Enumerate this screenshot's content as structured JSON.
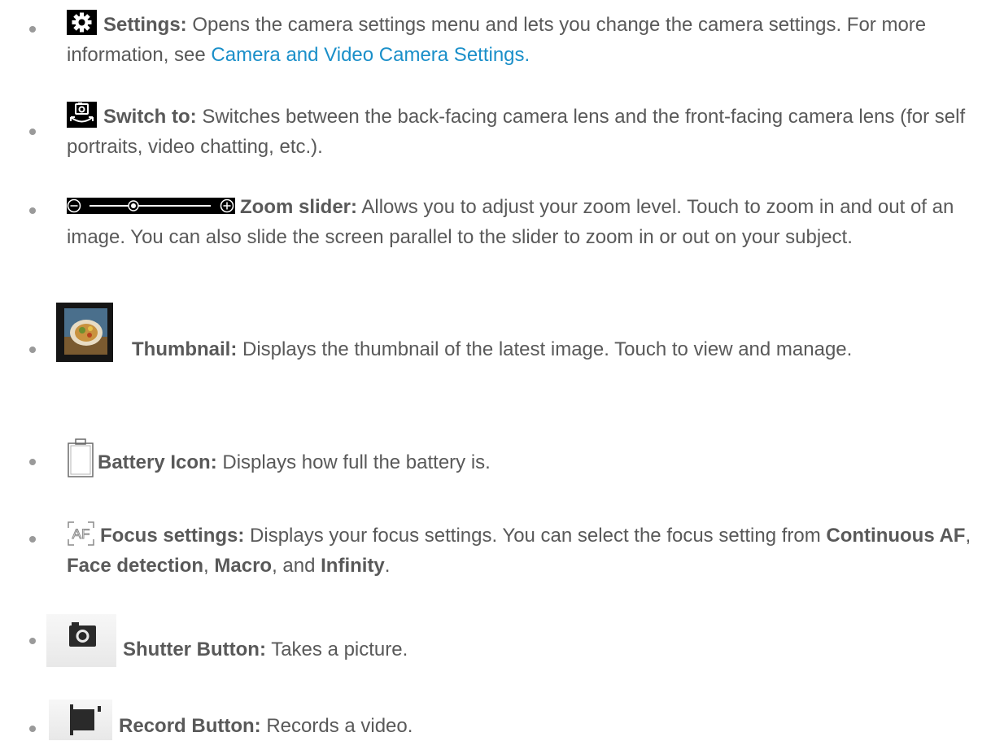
{
  "items": [
    {
      "icon": "gear-icon",
      "term": "Settings:",
      "text": " Opens the camera settings menu and lets you change the camera settings. For more information, see ",
      "link": "Camera and Video Camera Settings."
    },
    {
      "icon": "switch-camera-icon",
      "term": "Switch to:",
      "text": " Switches between the back-facing camera lens and the front-facing camera lens (for self portraits, video chatting, etc.)."
    },
    {
      "icon": "zoom-slider-icon",
      "term": "Zoom slider:",
      "text": " Allows you to adjust your zoom level. Touch to zoom in and out of an image. You can also slide the screen parallel to the slider to zoom in or out on your subject."
    },
    {
      "icon": "thumbnail-image-icon",
      "term": "Thumbnail:",
      "text": " Displays the thumbnail of the latest image. Touch to view and manage."
    },
    {
      "icon": "battery-icon",
      "term": "Battery Icon:",
      "text": " Displays how full the battery is."
    },
    {
      "icon": "focus-af-icon",
      "term": "Focus settings:",
      "text_a": " Displays your focus settings. You can select the focus setting from ",
      "opt1": "Continuous AF",
      "sep1": ", ",
      "opt2": "Face detection",
      "sep2": ", ",
      "opt3": "Macro",
      "sep3": ", and ",
      "opt4": "Infinity",
      "end": "."
    },
    {
      "icon": "camera-shutter-icon",
      "term": "Shutter Button:",
      "text": " Takes a picture."
    },
    {
      "icon": "video-camera-icon",
      "term": "Record Button:",
      "text": " Records a video."
    }
  ],
  "colors": {
    "text": "#595959",
    "link": "#1a8fc9",
    "bullet": "#9a9a9a"
  }
}
